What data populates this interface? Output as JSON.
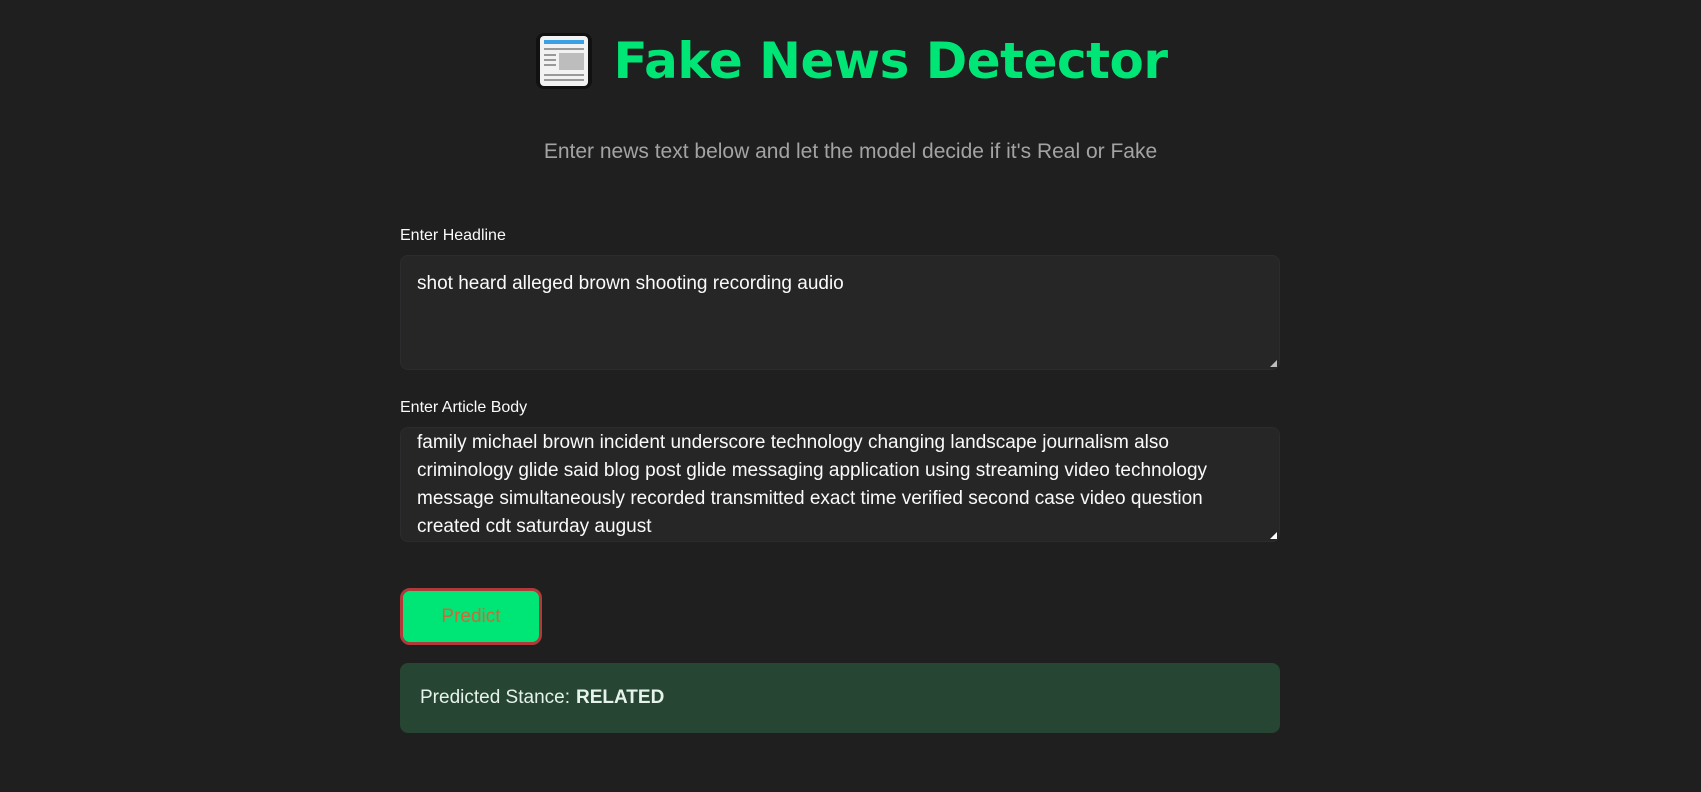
{
  "header": {
    "icon": "newspaper-icon",
    "title": "Fake News Detector",
    "subtitle": "Enter news text below and let the model decide if it's Real or Fake"
  },
  "form": {
    "headline": {
      "label": "Enter Headline",
      "value": "shot heard alleged brown shooting recording audio"
    },
    "body": {
      "label": "Enter Article Body",
      "value": "family michael brown incident underscore technology changing landscape journalism also criminology glide said blog post glide messaging application using streaming video technology message simultaneously recorded transmitted exact time verified second case video question created cdt saturday august"
    },
    "predict_label": "Predict"
  },
  "result": {
    "prefix": "Predicted Stance:",
    "value": "RELATED"
  },
  "colors": {
    "accent": "#00e676",
    "background": "#1f1f1f",
    "result_bg": "#264532"
  }
}
